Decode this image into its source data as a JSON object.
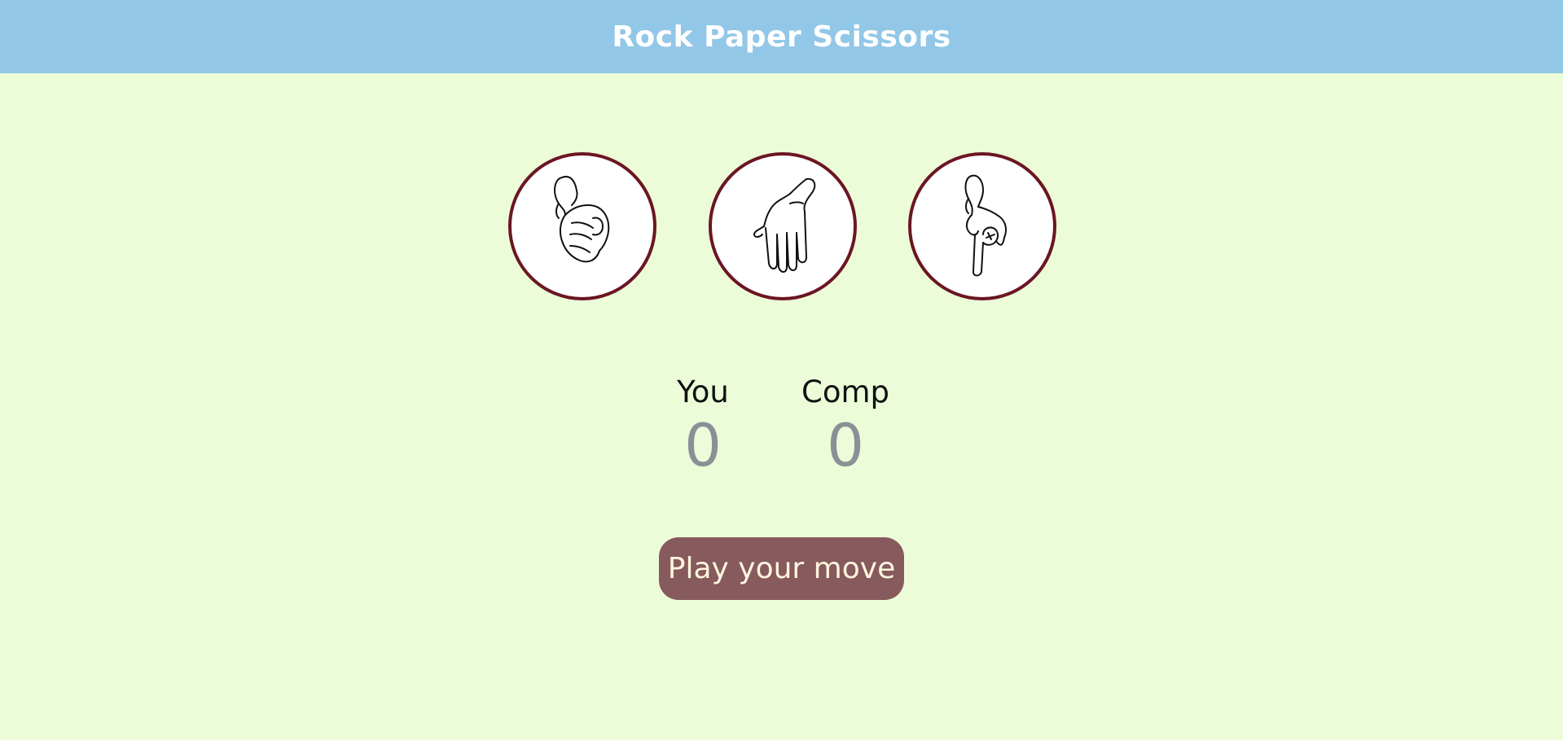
{
  "header": {
    "title": "Rock Paper Scissors"
  },
  "choices": [
    {
      "id": "rock",
      "icon": "rock-hand-icon"
    },
    {
      "id": "paper",
      "icon": "paper-hand-icon"
    },
    {
      "id": "scissors",
      "icon": "scissors-hand-icon"
    }
  ],
  "scoreboard": {
    "user": {
      "label": "You",
      "score": "0"
    },
    "comp": {
      "label": "Comp",
      "score": "0"
    }
  },
  "message": {
    "text": "Play your move"
  },
  "colors": {
    "background": "#ecfcd8",
    "header": "#92c7e7",
    "choice_border": "#6b1623",
    "message_bg": "#875a5d",
    "message_text": "#fff5de",
    "score_value": "#8a9096"
  }
}
